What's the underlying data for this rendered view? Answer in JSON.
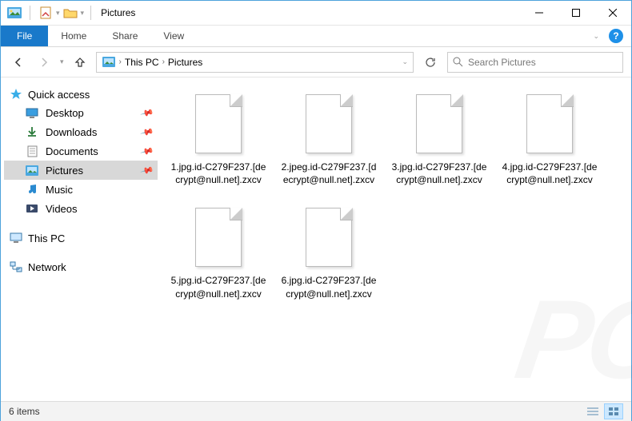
{
  "window": {
    "title": "Pictures"
  },
  "ribbon": {
    "file": "File",
    "tabs": [
      "Home",
      "Share",
      "View"
    ]
  },
  "breadcrumb": {
    "items": [
      "This PC",
      "Pictures"
    ]
  },
  "search": {
    "placeholder": "Search Pictures"
  },
  "sidebar": {
    "quick_access": {
      "label": "Quick access",
      "items": [
        {
          "label": "Desktop",
          "icon": "desktop",
          "pinned": true
        },
        {
          "label": "Downloads",
          "icon": "downloads",
          "pinned": true
        },
        {
          "label": "Documents",
          "icon": "documents",
          "pinned": true
        },
        {
          "label": "Pictures",
          "icon": "pictures",
          "pinned": true,
          "selected": true
        },
        {
          "label": "Music",
          "icon": "music",
          "pinned": false
        },
        {
          "label": "Videos",
          "icon": "videos",
          "pinned": false
        }
      ]
    },
    "this_pc": {
      "label": "This PC"
    },
    "network": {
      "label": "Network"
    }
  },
  "files": [
    {
      "name": "1.jpg.id-C279F237.[decrypt@null.net].zxcv"
    },
    {
      "name": "2.jpeg.id-C279F237.[decrypt@null.net].zxcv"
    },
    {
      "name": "3.jpg.id-C279F237.[decrypt@null.net].zxcv"
    },
    {
      "name": "4.jpg.id-C279F237.[decrypt@null.net].zxcv"
    },
    {
      "name": "5.jpg.id-C279F237.[decrypt@null.net].zxcv"
    },
    {
      "name": "6.jpg.id-C279F237.[decrypt@null.net].zxcv"
    }
  ],
  "status": {
    "text": "6 items"
  }
}
